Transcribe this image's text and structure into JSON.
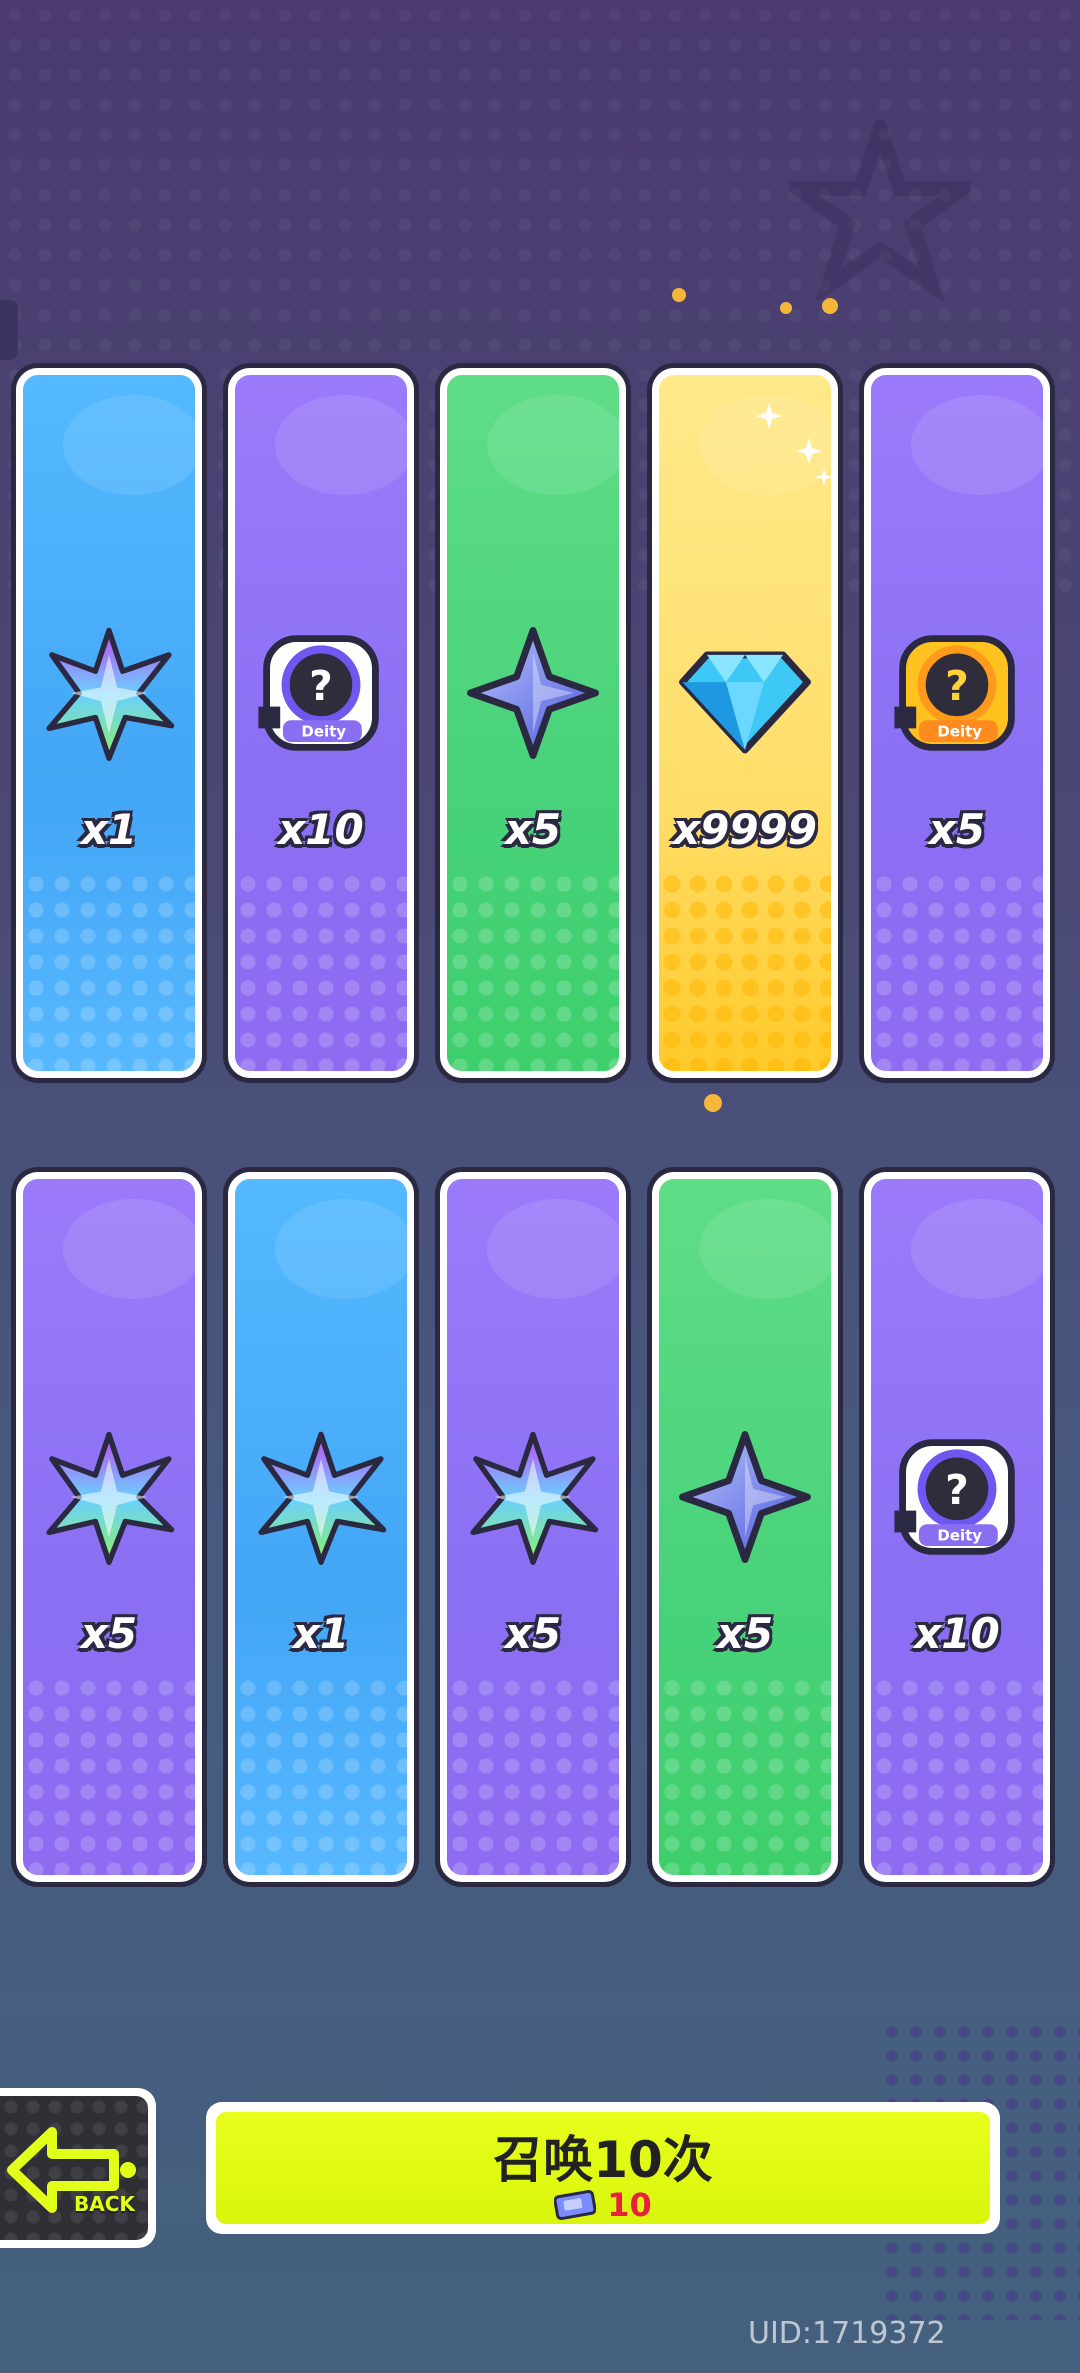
{
  "screen": "summon-results",
  "colors": {
    "blue": "#4aaeff",
    "purple": "#8f72f5",
    "green": "#4ad67a",
    "yellow": "#ffdc5a",
    "button_yellow": "#e2fa14",
    "cost_red": "#e8203c"
  },
  "rewards": [
    {
      "item": "rainbow-crystal-icon",
      "quantity": "x1",
      "card_color": "blue"
    },
    {
      "item": "deity-mystery-badge-icon",
      "quantity": "x10",
      "card_color": "purple"
    },
    {
      "item": "blue-star-shard-icon",
      "quantity": "x5",
      "card_color": "green"
    },
    {
      "item": "diamond-icon",
      "quantity": "x9999",
      "card_color": "yellow"
    },
    {
      "item": "golden-deity-mystery-badge-icon",
      "quantity": "x5",
      "card_color": "purple"
    },
    {
      "item": "rainbow-crystal-icon",
      "quantity": "x5",
      "card_color": "purple"
    },
    {
      "item": "rainbow-crystal-icon",
      "quantity": "x1",
      "card_color": "blue"
    },
    {
      "item": "rainbow-crystal-icon",
      "quantity": "x5",
      "card_color": "purple"
    },
    {
      "item": "blue-star-shard-icon",
      "quantity": "x5",
      "card_color": "green"
    },
    {
      "item": "deity-mystery-badge-icon",
      "quantity": "x10",
      "card_color": "purple"
    }
  ],
  "badge_text": "Deity",
  "back_button": {
    "label": "BACK",
    "icon": "arrow-left-icon"
  },
  "summon_button": {
    "label": "召唤10次",
    "cost_icon": "summon-ticket-icon",
    "cost": "10"
  },
  "uid": "UID:1719372"
}
